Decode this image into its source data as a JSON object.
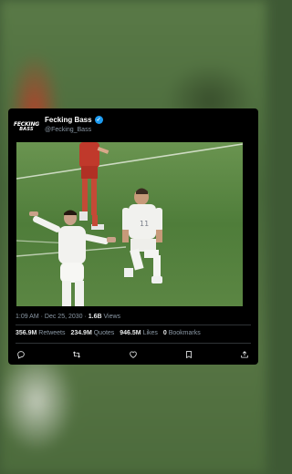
{
  "post": {
    "account_name": "Fecking Bass",
    "handle": "@Fecking_Bass",
    "avatar_line1": "FECKING",
    "avatar_line2": "BASS",
    "timestamp": "1:09 AM · Dec 25, 2030 · ",
    "views_count": "1.6B",
    "views_label": " Views"
  },
  "stats": {
    "retweets_count": "356.9M",
    "retweets_label": " Retweets",
    "quotes_count": "234.9M",
    "quotes_label": " Quotes",
    "likes_count": "946.5M",
    "likes_label": " Likes",
    "bookmarks_count": "0",
    "bookmarks_label": " Bookmarks"
  },
  "media": {
    "player_number": "11"
  },
  "actions": [
    "reply-icon",
    "retweet-icon",
    "like-icon",
    "bookmark-icon",
    "share-icon"
  ],
  "colors": {
    "card_bg": "#000000",
    "verified": "#1d9bf0",
    "secondary_text": "#8b98a5",
    "primary_text": "#e7e9ea"
  }
}
